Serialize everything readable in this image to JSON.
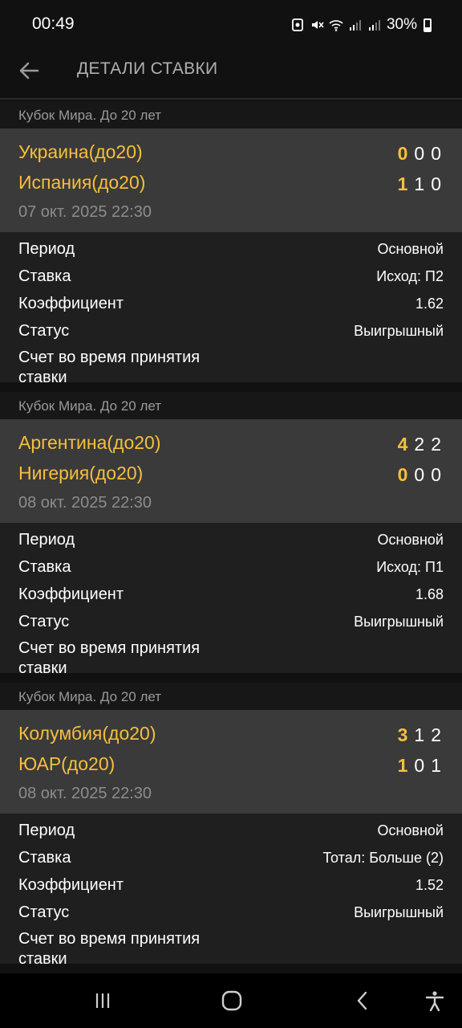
{
  "status_bar": {
    "time": "00:49",
    "battery": "30%"
  },
  "header": {
    "title": "ДЕТАЛИ СТАВКИ"
  },
  "bets": [
    {
      "league": "Кубок Мира. До 20 лет",
      "team1": "Украина(до20)",
      "team2": "Испания(до20)",
      "team1_scores": [
        "0",
        "0",
        "0"
      ],
      "team2_scores": [
        "1",
        "1",
        "0"
      ],
      "date": "07 окт. 2025 22:30",
      "rows": [
        {
          "label": "Период",
          "value": "Основной"
        },
        {
          "label": "Ставка",
          "value": "Исход: П2"
        },
        {
          "label": "Коэффициент",
          "value": "1.62"
        },
        {
          "label": "Статус",
          "value": "Выигрышный"
        },
        {
          "label": "Счет во время принятия ставки",
          "value": ""
        }
      ]
    },
    {
      "league": "Кубок Мира. До 20 лет",
      "team1": "Аргентина(до20)",
      "team2": "Нигерия(до20)",
      "team1_scores": [
        "4",
        "2",
        "2"
      ],
      "team2_scores": [
        "0",
        "0",
        "0"
      ],
      "date": "08 окт. 2025 22:30",
      "rows": [
        {
          "label": "Период",
          "value": "Основной"
        },
        {
          "label": "Ставка",
          "value": "Исход: П1"
        },
        {
          "label": "Коэффициент",
          "value": "1.68"
        },
        {
          "label": "Статус",
          "value": "Выигрышный"
        },
        {
          "label": "Счет во время принятия ставки",
          "value": ""
        }
      ]
    },
    {
      "league": "Кубок Мира. До 20 лет",
      "team1": "Колумбия(до20)",
      "team2": "ЮАР(до20)",
      "team1_scores": [
        "3",
        "1",
        "2"
      ],
      "team2_scores": [
        "1",
        "0",
        "1"
      ],
      "date": "08 окт. 2025 22:30",
      "rows": [
        {
          "label": "Период",
          "value": "Основной"
        },
        {
          "label": "Ставка",
          "value": "Тотал: Больше (2)"
        },
        {
          "label": "Коэффициент",
          "value": "1.52"
        },
        {
          "label": "Статус",
          "value": "Выигрышный"
        },
        {
          "label": "Счет во время принятия ставки",
          "value": ""
        }
      ]
    }
  ],
  "icons": {
    "back": "arrow-left-icon",
    "recents": "recents-icon",
    "home": "home-icon",
    "nav_back": "chevron-left-icon",
    "accessibility": "accessibility-icon"
  },
  "colors": {
    "accent": "#f6bf3c",
    "match_bg": "#3a3a3a",
    "details_bg": "#1f1f1f",
    "background": "#111111"
  }
}
